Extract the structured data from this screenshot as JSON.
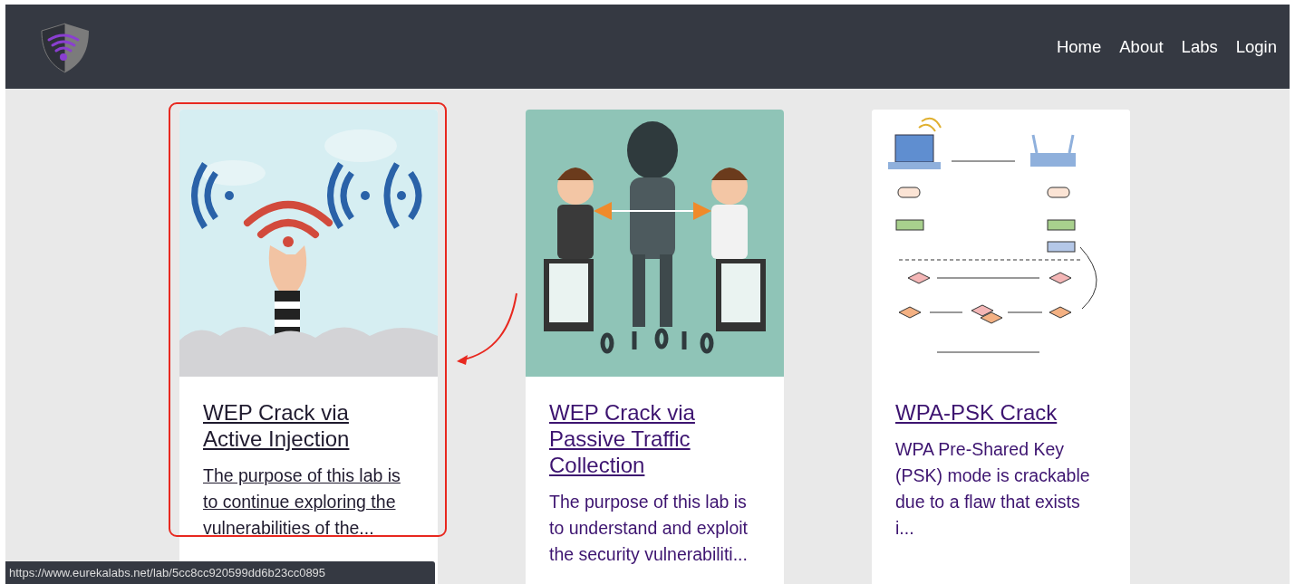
{
  "navbar": {
    "links": [
      {
        "label": "Home"
      },
      {
        "label": "About"
      },
      {
        "label": "Labs"
      },
      {
        "label": "Login"
      }
    ]
  },
  "cards": [
    {
      "kind": "signal",
      "title": "WEP Crack via Active Injection",
      "description": "The purpose of this lab is to continue exploring the vulnerabilities of the...",
      "hovered": true
    },
    {
      "kind": "eavesdrop",
      "title": "WEP Crack via Passive Traffic Collection",
      "description": "The purpose of this lab is to understand and exploit the security vulnerabiliti...",
      "hovered": false
    },
    {
      "kind": "diagram",
      "title": "WPA-PSK Crack",
      "description": "WPA Pre-Shared Key (PSK) mode is crackable due to a flaw that exists i...",
      "hovered": false
    }
  ],
  "status_bar": {
    "url": "https://www.eurekalabs.net/lab/5cc8cc920599dd6b23cc0895"
  }
}
